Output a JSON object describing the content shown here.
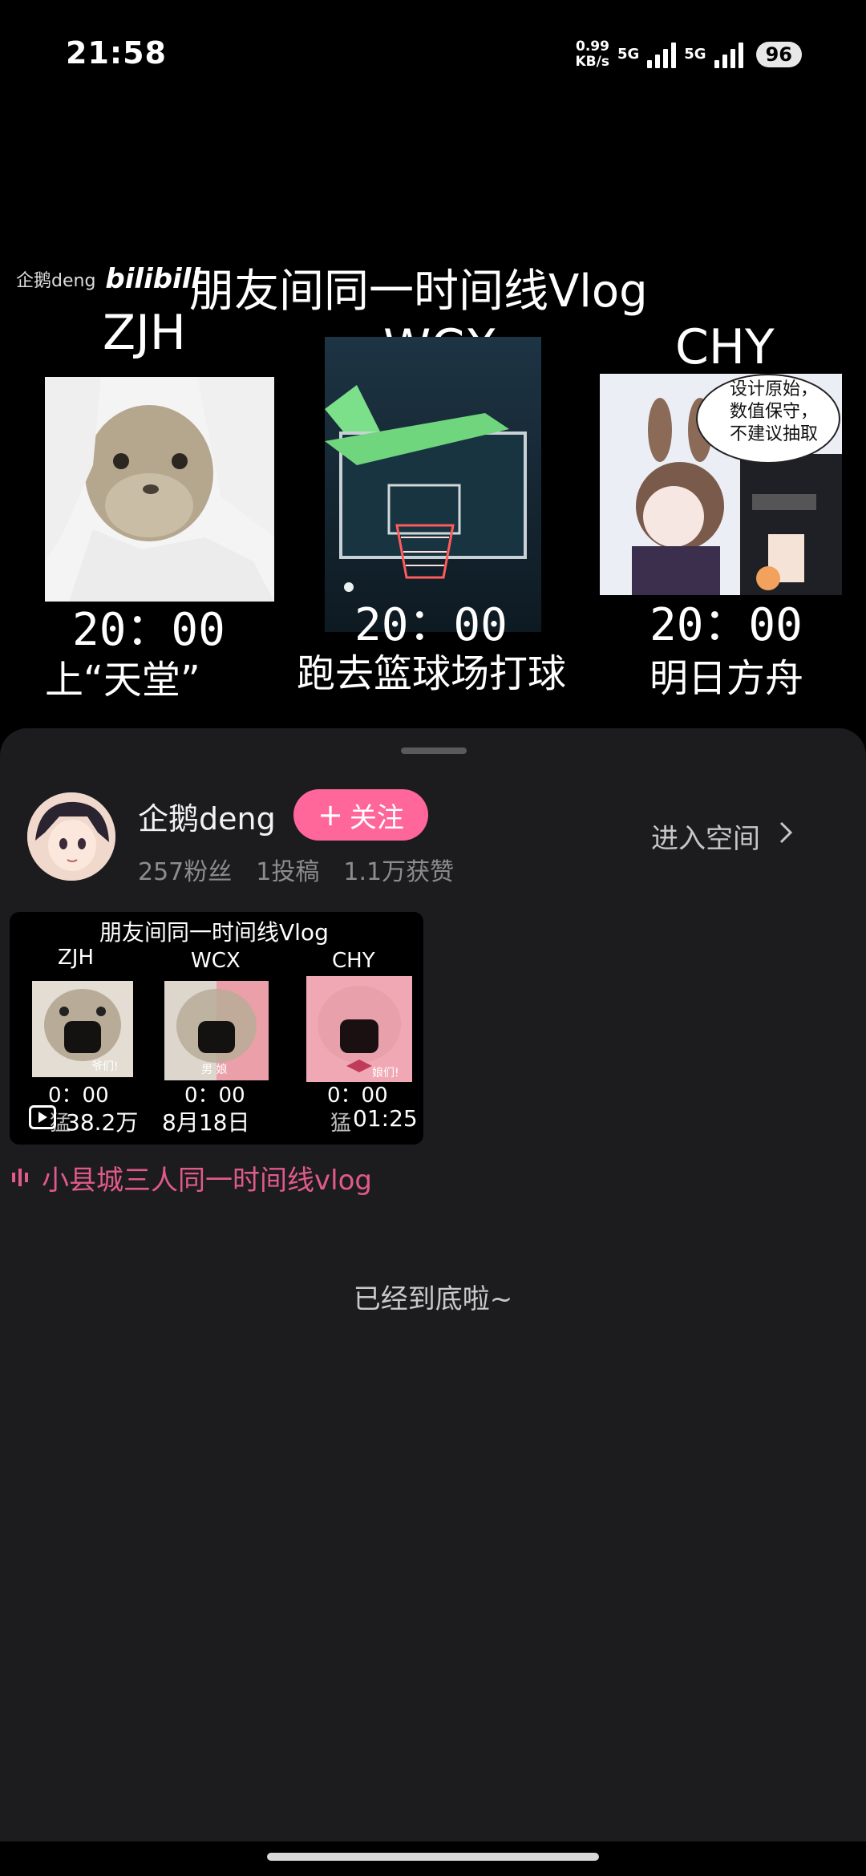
{
  "status": {
    "time": "21:58",
    "net_speed_top": "0.99",
    "net_speed_bottom": "KB/s",
    "network1": "5G",
    "network2": "5G",
    "battery": "96"
  },
  "video": {
    "watermark_user": "企鹅deng",
    "watermark_logo": "bilibili",
    "title": "朋友间同一时间线Vlog",
    "columns": [
      {
        "name": "ZJH",
        "time": "20：00",
        "activity": "上“天堂”"
      },
      {
        "name": "WCX",
        "time": "20：00",
        "activity": "跑去篮球场打球"
      },
      {
        "name": "CHY",
        "time": "20：00",
        "activity": "明日方舟"
      }
    ],
    "comic_bubble": [
      "设计原始，",
      "数值保守，",
      "不建议抽取"
    ]
  },
  "uploader": {
    "name": "企鹅deng",
    "follow_label": "关注",
    "fans": "257粉丝",
    "posts": "1投稿",
    "likes": "1.1万获赞",
    "enter_label": "进入空间"
  },
  "video_card": {
    "title": "朋友间同一时间线Vlog",
    "names": [
      "ZJH",
      "WCX",
      "CHY"
    ],
    "times": [
      "0：00",
      "0：00",
      "0：00"
    ],
    "thumb_captions": [
      "爷们!",
      "男  娘",
      "娘们!"
    ],
    "views": "38.2万",
    "date": "8月18日",
    "duration": "01:25",
    "overlap_text": [
      "猛",
      "猛"
    ]
  },
  "playlist": {
    "label": "小县城三人同一时间线vlog"
  },
  "footer": {
    "end_text": "已经到底啦~"
  },
  "colors": {
    "accent": "#ff6699",
    "playlist_pink": "#e05a8a",
    "sheet_bg": "#1c1c1e"
  }
}
